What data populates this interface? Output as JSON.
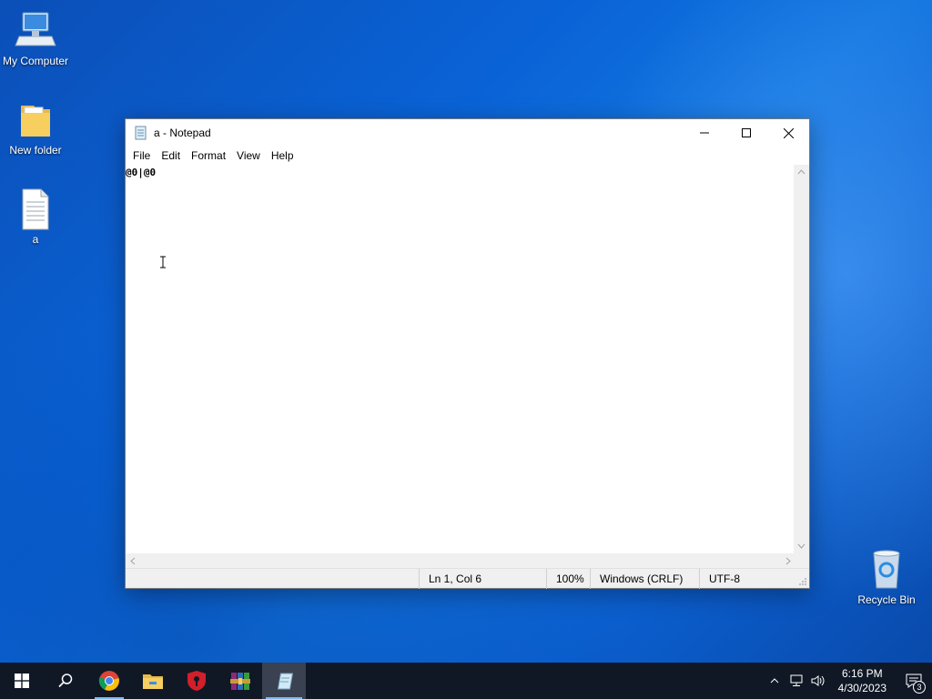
{
  "desktop": {
    "icons": [
      {
        "label": "My Computer"
      },
      {
        "label": "New folder"
      },
      {
        "label": "a"
      },
      {
        "label": "Recycle Bin"
      }
    ]
  },
  "window": {
    "title": "a - Notepad",
    "menu": [
      "File",
      "Edit",
      "Format",
      "View",
      "Help"
    ],
    "content": "@0|@0",
    "status": {
      "position": "Ln 1, Col 6",
      "zoom": "100%",
      "line_ending": "Windows (CRLF)",
      "encoding": "UTF-8"
    }
  },
  "taskbar": {
    "apps": [
      "windows-start",
      "search",
      "chrome",
      "file-explorer",
      "shield-app",
      "winrar",
      "notepad"
    ],
    "clock_time": "6:16 PM",
    "clock_date": "4/30/2023",
    "notification_count": "3"
  },
  "colors": {
    "accent": "#0a63d6",
    "taskbar": "#101826",
    "active_underline": "#7fb8f0"
  }
}
